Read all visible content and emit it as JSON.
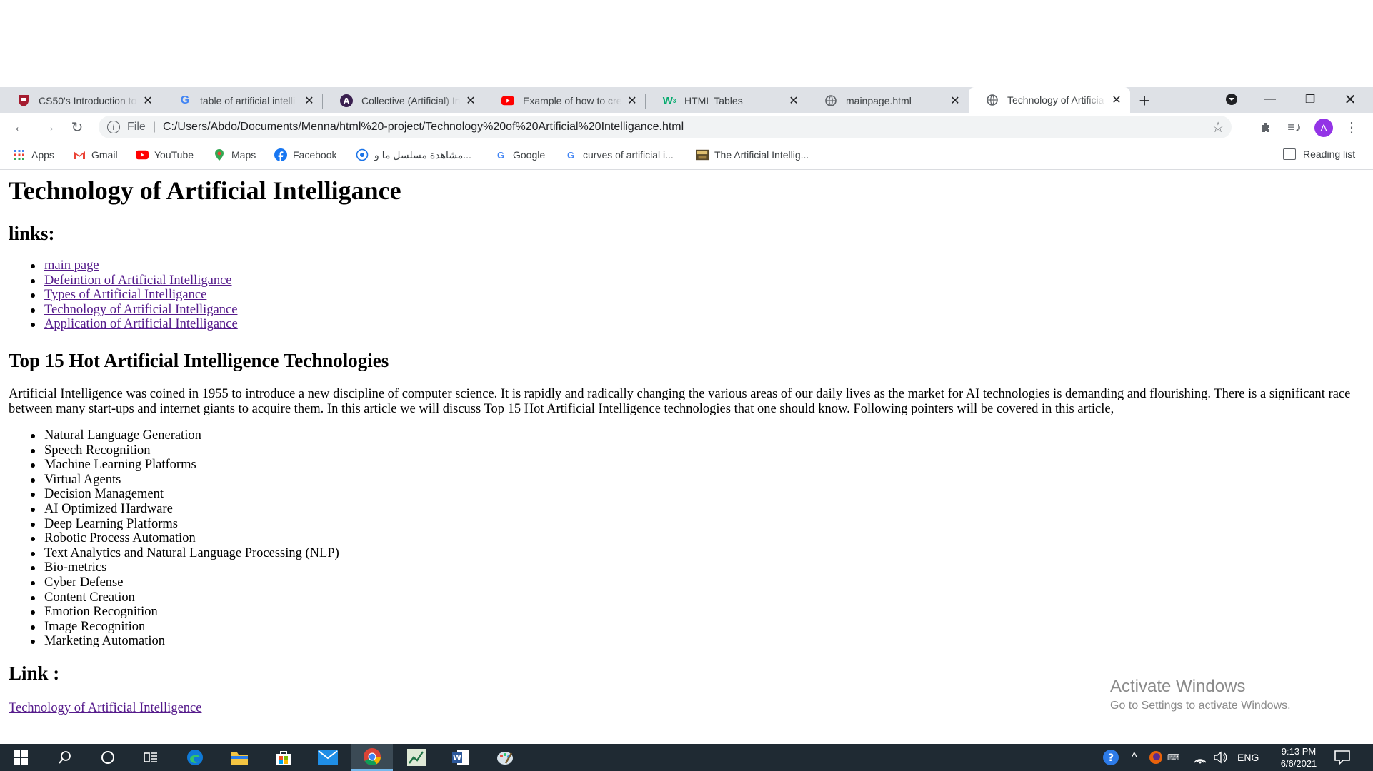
{
  "browser": {
    "tabs": [
      {
        "title": "CS50's Introduction to",
        "icon": "harvard-shield-icon",
        "active": false
      },
      {
        "title": "table of artificial intelli",
        "icon": "google-icon",
        "active": false
      },
      {
        "title": "Collective (Artificial) In",
        "icon": "collective-a-icon",
        "active": false
      },
      {
        "title": "Example of how to cre",
        "icon": "youtube-icon",
        "active": false
      },
      {
        "title": "HTML Tables",
        "icon": "w3schools-icon",
        "active": false
      },
      {
        "title": "mainpage.html",
        "icon": "globe-icon",
        "active": false
      },
      {
        "title": "Technology of Artificia",
        "icon": "globe-icon",
        "active": true
      }
    ],
    "address": {
      "scheme_label": "File",
      "url": "C:/Users/Abdo/Documents/Menna/html%20-project/Technology%20of%20Artificial%20Intelligance.html"
    },
    "avatar_letter": "A",
    "bookmarks": [
      {
        "label": "Apps",
        "icon": "apps-grid-icon"
      },
      {
        "label": "Gmail",
        "icon": "gmail-icon"
      },
      {
        "label": "YouTube",
        "icon": "youtube-icon"
      },
      {
        "label": "Maps",
        "icon": "maps-icon"
      },
      {
        "label": "Facebook",
        "icon": "facebook-icon"
      },
      {
        "label": "مشاهدة مسلسل ما و...",
        "icon": "location-icon"
      },
      {
        "label": "Google",
        "icon": "google-icon"
      },
      {
        "label": "curves of artificial i...",
        "icon": "google-icon"
      },
      {
        "label": "The Artificial Intellig...",
        "icon": "bookmark-image-icon"
      }
    ],
    "reading_list": "Reading list"
  },
  "page": {
    "title": "Technology of Artificial Intelligance",
    "links_heading": "links:",
    "nav_links": [
      "main page",
      "Defeintion of Artificial Intelligance",
      "Types of Artificial Intelligance",
      "Technology of Artificial Intelligance",
      "Application of Artificial Intelligance"
    ],
    "section_heading": "Top 15 Hot Artificial Intelligence Technologies",
    "intro": "Artificial Intelligence was coined in 1955 to introduce a new discipline of computer science. It is rapidly and radically changing the various areas of our daily lives as the market for AI technologies is demanding and flourishing. There is a significant race between many start-ups and internet giants to acquire them. In this article we will discuss Top 15 Hot Artificial Intelligence technologies that one should know. Following pointers will be covered in this article,",
    "technologies": [
      "Natural Language Generation",
      "Speech Recognition",
      "Machine Learning Platforms",
      "Virtual Agents",
      "Decision Management",
      "AI Optimized Hardware",
      "Deep Learning Platforms",
      "Robotic Process Automation",
      "Text Analytics and Natural Language Processing (NLP)",
      "Bio-metrics",
      "Cyber Defense",
      "Content Creation",
      "Emotion Recognition",
      "Image Recognition",
      "Marketing Automation"
    ],
    "link_heading": "Link :",
    "footer_link": "Technology of Artificial Intelligence"
  },
  "watermark": {
    "line1": "Activate Windows",
    "line2": "Go to Settings to activate Windows."
  },
  "taskbar": {
    "language": "ENG",
    "time": "9:13 PM",
    "date": "6/6/2021"
  },
  "colors": {
    "link": "#551a8b",
    "taskbar": "#1f2a33",
    "tabstrip": "#dee1e6",
    "avatar": "#9334e6"
  }
}
